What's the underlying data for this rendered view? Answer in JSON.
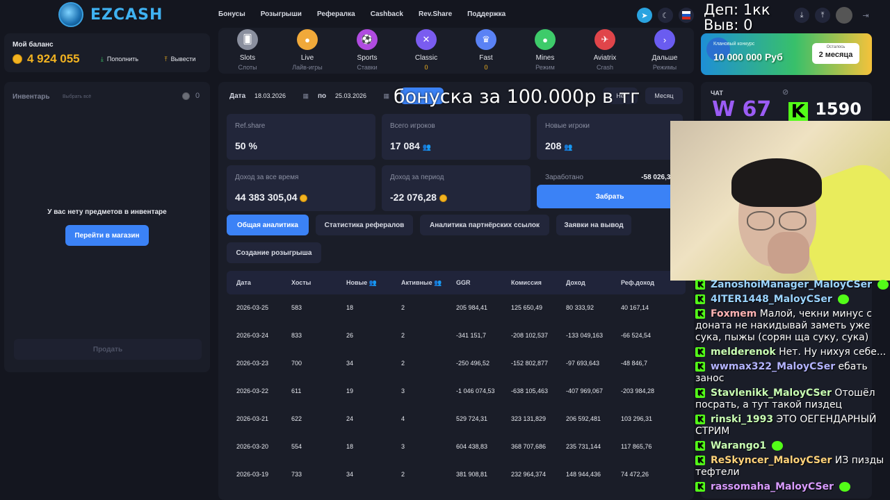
{
  "header": {
    "logo_text": "EZCASH",
    "nav": [
      "Бонусы",
      "Розыгрыши",
      "Рефералка",
      "Cashback",
      "Rev.Share",
      "Поддержка"
    ]
  },
  "stream_overlay": {
    "deposit": "Деп: 1кк",
    "withdraw": "Выв: 0",
    "subtitle": "бонуска за 100.000р в тг",
    "w_label": "W 67",
    "k_label": "1590"
  },
  "balance": {
    "title": "Мой баланс",
    "amount": "4 924 055",
    "deposit_btn": "Пополнить",
    "withdraw_btn": "Вывести"
  },
  "inventory": {
    "title": "Инвентарь",
    "select_all": "Выбрать всё",
    "count": "0",
    "empty_text": "У вас нету предметов в инвентаре",
    "shop_btn": "Перейти в магазин",
    "sell_btn": "Продать"
  },
  "games": [
    {
      "name": "Slots",
      "sub": "Слоты",
      "color": "#8a8f9e",
      "icon": "card-icon",
      "sub_color": "#7c8194"
    },
    {
      "name": "Live",
      "sub": "Лайв-игры",
      "color": "#f0a93a",
      "icon": "person-icon",
      "sub_color": "#7c8194"
    },
    {
      "name": "Sports",
      "sub": "Ставки",
      "color": "#b04be0",
      "icon": "ball-icon",
      "sub_color": "#7c8194"
    },
    {
      "name": "Classic",
      "sub": "0",
      "color": "#7a5cf0",
      "icon": "cross-icon",
      "sub_color": "#f2b321"
    },
    {
      "name": "Fast",
      "sub": "0",
      "color": "#5a82f5",
      "icon": "crown-icon",
      "sub_color": "#f2b321"
    },
    {
      "name": "Mines",
      "sub": "Режим",
      "color": "#3ecb6a",
      "icon": "bomb-icon",
      "sub_color": "#7c8194"
    },
    {
      "name": "Aviatrix",
      "sub": "Crash",
      "color": "#e0454a",
      "icon": "plane-icon",
      "sub_color": "#7c8194"
    },
    {
      "name": "Дальше",
      "sub": "Режимы",
      "color": "#6a5cf0",
      "icon": "chevron-right-icon",
      "sub_color": "#7c8194"
    }
  ],
  "filters": {
    "date_label": "Дата",
    "from": "18.03.2026",
    "to_label": "по",
    "to": "25.03.2026",
    "period_btns": [
      "Неделя",
      "Месяц"
    ],
    "partial_btn": "Не"
  },
  "stats": [
    {
      "label": "Ref.share",
      "value": "50 %",
      "icon": ""
    },
    {
      "label": "Всего игроков",
      "value": "17 084",
      "icon": "users"
    },
    {
      "label": "Новые игроки",
      "value": "208",
      "icon": "users"
    },
    {
      "label": "Доход за все время",
      "value": "44 383 305,04",
      "icon": "coin"
    },
    {
      "label": "Доход за период",
      "value": "-22 076,28",
      "icon": "coin"
    },
    {
      "label": "Заработано",
      "value": "-58 026,31",
      "icon": "coin"
    }
  ],
  "claim_btn": "Забрать",
  "tabs": [
    "Общая аналитика",
    "Статистика рефералов",
    "Аналитика партнёрских ссылок",
    "Заявки на вывод",
    "Создание розыгрыша"
  ],
  "table": {
    "headers": [
      "Дата",
      "Хосты",
      "Новые",
      "Активные",
      "GGR",
      "Комиссия",
      "Доход",
      "Реф.доход"
    ],
    "rows": [
      [
        "2026-03-25",
        "583",
        "18",
        "2",
        "205 984,41",
        "125 650,49",
        "80 333,92",
        "40 167,14"
      ],
      [
        "2026-03-24",
        "833",
        "26",
        "2",
        "-341 151,7",
        "-208 102,537",
        "-133 049,163",
        "-66 524,54"
      ],
      [
        "2026-03-23",
        "700",
        "34",
        "2",
        "-250 496,52",
        "-152 802,877",
        "-97 693,643",
        "-48 846,7"
      ],
      [
        "2026-03-22",
        "611",
        "19",
        "3",
        "-1 046 074,53",
        "-638 105,463",
        "-407 969,067",
        "-203 984,28"
      ],
      [
        "2026-03-21",
        "622",
        "24",
        "4",
        "529 724,31",
        "323 131,829",
        "206 592,481",
        "103 296,31"
      ],
      [
        "2026-03-20",
        "554",
        "18",
        "3",
        "604 438,83",
        "368 707,686",
        "235 731,144",
        "117 865,76"
      ],
      [
        "2026-03-19",
        "733",
        "34",
        "2",
        "381 908,81",
        "232 964,374",
        "148 944,436",
        "74 472,26"
      ]
    ]
  },
  "banner": {
    "text": "10 000 000 Руб",
    "subtext": "Клановый конкурс",
    "left_label": "Осталось",
    "left_value": "2 месяца"
  },
  "chat": {
    "title": "ЧАТ",
    "messages": [
      {
        "user": "ZanoshoiManager_MaloyCSer",
        "text": "",
        "color": "#9bd4ff",
        "emote": true
      },
      {
        "user": "4ITER1448_MaloyCSer",
        "text": "",
        "color": "#9bd4ff",
        "emote": true
      },
      {
        "user": "Foxmem",
        "text": "Малой, чекни минус с доната не накидывай заметь уже сука, пыжы (сорян ща суку, сука)",
        "color": "#ffb3b3",
        "emote": false
      },
      {
        "user": "melderenok",
        "text": "Нет. Ну нихуя себе...",
        "color": "#c9ffb3",
        "emote": false
      },
      {
        "user": "wwmax322_MaloyCSer",
        "text": "ебать занос",
        "color": "#b3b3ff",
        "emote": false
      },
      {
        "user": "Stavlenikk_MaloyCSer",
        "text": "Отошёл посрать, а тут такой пиздец",
        "color": "#c9ffb3",
        "emote": false
      },
      {
        "user": "rinski_1993",
        "text": "ЭТО ОЕГЕНДАРНЫЙ СТРИМ",
        "color": "#c9ffb3",
        "emote": false
      },
      {
        "user": "Warango1",
        "text": "",
        "color": "#c9ffb3",
        "emote": true
      },
      {
        "user": "ReSkyncer_MaloyCSer",
        "text": "ИЗ пизды тефтели",
        "color": "#ffd27a",
        "emote": false
      },
      {
        "user": "rassomaha_MaloyCSer",
        "text": "",
        "color": "#d99bff",
        "emote": true
      }
    ]
  }
}
